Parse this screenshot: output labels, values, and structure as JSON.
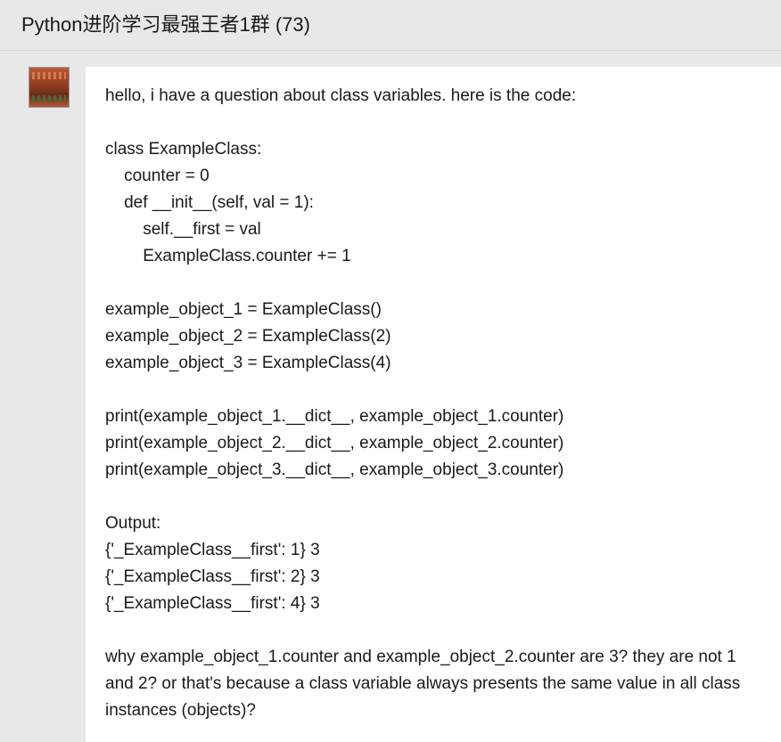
{
  "header": {
    "group_name": "Python进阶学习最强王者1群",
    "member_count": "(73)"
  },
  "message": {
    "intro": "hello, i have a question about class variables. here is the code:",
    "code": [
      "class ExampleClass:",
      "    counter = 0",
      "    def __init__(self, val = 1):",
      "        self.__first = val",
      "        ExampleClass.counter += 1",
      "",
      "example_object_1 = ExampleClass()",
      "example_object_2 = ExampleClass(2)",
      "example_object_3 = ExampleClass(4)",
      "",
      "print(example_object_1.__dict__, example_object_1.counter)",
      "print(example_object_2.__dict__, example_object_2.counter)",
      "print(example_object_3.__dict__, example_object_3.counter)"
    ],
    "output_label": "Output:",
    "output_lines": [
      "{'_ExampleClass__first': 1} 3",
      "{'_ExampleClass__first': 2} 3",
      "{'_ExampleClass__first': 4} 3"
    ],
    "question": "why example_object_1.counter and example_object_2.counter are 3? they are not 1 and 2? or that's because  a class variable always presents the same value in all class instances (objects)?"
  }
}
